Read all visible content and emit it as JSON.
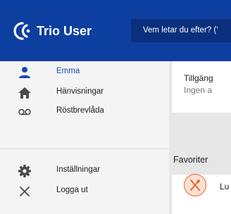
{
  "header": {
    "app_title": "Trio User",
    "search_placeholder": "Vem letar du efter? (‘"
  },
  "sidebar": {
    "items": [
      {
        "label": "Emma",
        "icon": "person-icon",
        "active": true
      },
      {
        "label": "Hänvisningar",
        "icon": "home-icon",
        "active": false
      },
      {
        "label": "Röstbrevlåda",
        "icon": "voicemail-icon",
        "active": false
      },
      {
        "label": "Inställningar",
        "icon": "gear-icon",
        "active": false
      },
      {
        "label": "Logga ut",
        "icon": "close-icon",
        "active": false
      }
    ]
  },
  "main": {
    "status_card": {
      "title": "Tillgäng",
      "subtitle": "Ingen a"
    },
    "favorites": {
      "title": "Favoriter",
      "items": [
        {
          "label": "Lu",
          "icon": "utensils-icon"
        }
      ]
    }
  },
  "colors": {
    "header_bg": "#0d3fa0",
    "search_bg": "#0a2f7d",
    "active_text": "#1a47b5",
    "favorite_accent": "#e56a3a"
  }
}
